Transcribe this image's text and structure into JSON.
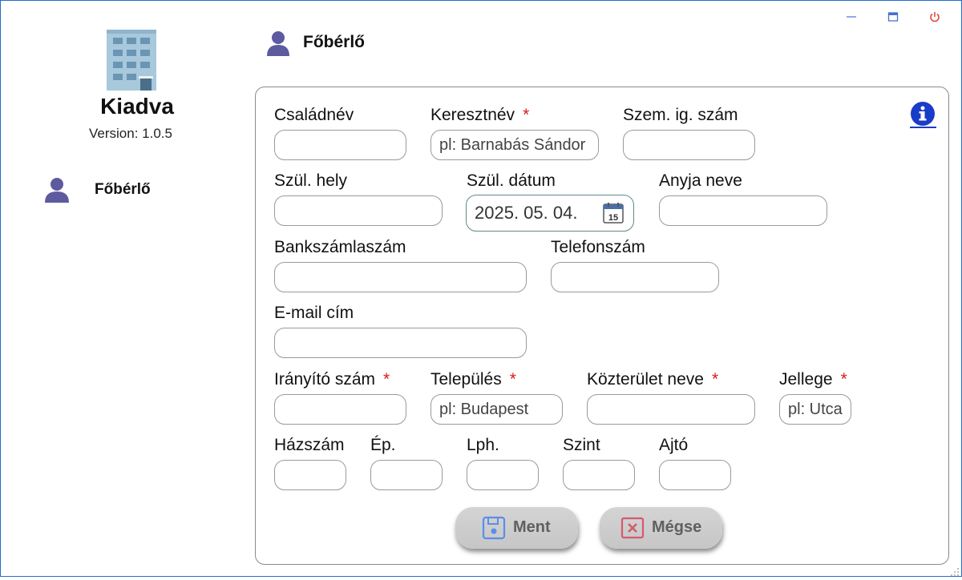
{
  "window": {
    "colors": {
      "border": "#1e6fd0",
      "accent": "#2058d8",
      "close": "#e04030"
    }
  },
  "sidebar": {
    "app_name": "Kiadva",
    "version": "Version: 1.0.5",
    "logo_icon": "building-icon",
    "items": [
      {
        "label": "Főbérlő",
        "icon": "person-icon"
      }
    ]
  },
  "page": {
    "title": "Főbérlő",
    "icon": "person-icon"
  },
  "form": {
    "info_icon": "info-icon",
    "fields": {
      "csaladnev": {
        "label": "Családnév",
        "value": "",
        "placeholder": ""
      },
      "keresztnev": {
        "label": "Keresztnév",
        "required": "*",
        "value": "",
        "placeholder": "pl: Barnabás Sándor"
      },
      "szem_ig_szam": {
        "label": "Szem. ig. szám",
        "value": "",
        "placeholder": ""
      },
      "szul_hely": {
        "label": "Szül. hely",
        "value": "",
        "placeholder": ""
      },
      "szul_datum": {
        "label": "Szül. dátum",
        "value": "2025. 05. 04.",
        "icon": "calendar-icon",
        "calendar_day": "15"
      },
      "anyja_neve": {
        "label": "Anyja neve",
        "value": "",
        "placeholder": ""
      },
      "bankszamlaszam": {
        "label": "Bankszámlaszám",
        "value": "",
        "placeholder": ""
      },
      "telefonszam": {
        "label": "Telefonszám",
        "value": "",
        "placeholder": ""
      },
      "email": {
        "label": "E-mail cím",
        "value": "",
        "placeholder": ""
      },
      "iranyitoszam": {
        "label": "Irányító szám",
        "required": "*",
        "value": "",
        "placeholder": ""
      },
      "telepules": {
        "label": "Település",
        "required": "*",
        "value": "",
        "placeholder": "pl: Budapest"
      },
      "kozterulet_neve": {
        "label": "Közterület neve",
        "required": "*",
        "value": "",
        "placeholder": ""
      },
      "jellege": {
        "label": "Jellege",
        "required": "*",
        "value": "",
        "placeholder": "pl: Utca"
      },
      "hazszam": {
        "label": "Házszám",
        "value": "",
        "placeholder": ""
      },
      "ep": {
        "label": "Ép.",
        "value": "",
        "placeholder": ""
      },
      "lph": {
        "label": "Lph.",
        "value": "",
        "placeholder": ""
      },
      "szint": {
        "label": "Szint",
        "value": "",
        "placeholder": ""
      },
      "ajto": {
        "label": "Ajtó",
        "value": "",
        "placeholder": ""
      }
    },
    "buttons": {
      "save": {
        "label": "Ment",
        "icon": "floppy-disk-icon"
      },
      "cancel": {
        "label": "Mégse",
        "icon": "x-box-icon"
      }
    }
  }
}
